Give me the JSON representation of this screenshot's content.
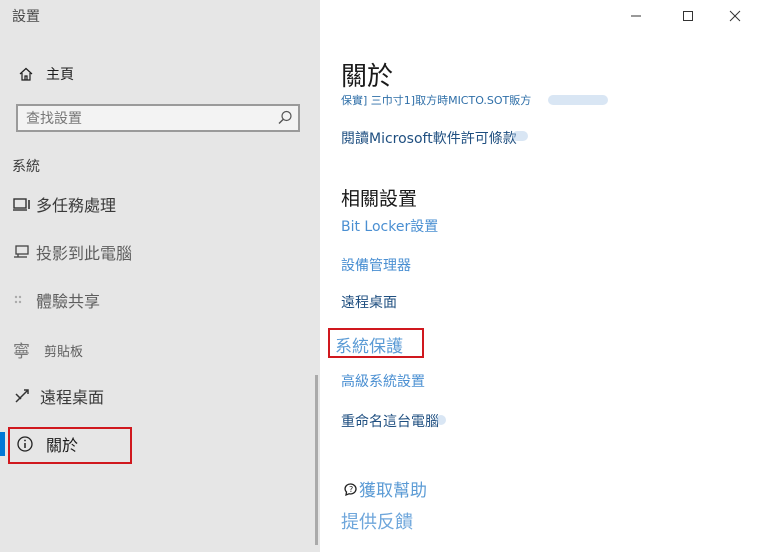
{
  "window": {
    "title": "設置",
    "controls": {
      "minimize": "minimize-icon",
      "maximize": "maximize-icon",
      "close": "close-icon"
    }
  },
  "sidebar": {
    "home_label": "主頁",
    "search_placeholder": "查找設置",
    "section_title": "系統",
    "items": [
      {
        "label": "多任務處理",
        "icon": "multitasking-icon"
      },
      {
        "label": "投影到此電腦",
        "icon": "project-icon"
      },
      {
        "label": "體驗共享",
        "icon": "shared-experiences-icon"
      },
      {
        "label": "剪貼板",
        "icon": "clipboard-icon"
      },
      {
        "label": "遠程桌面",
        "icon": "remote-desktop-icon"
      },
      {
        "label": "關於",
        "icon": "info-icon",
        "active": true
      }
    ]
  },
  "main": {
    "title": "關於",
    "service_link": "保實] 三巾寸1]取方時MICTO.SOT販方",
    "license_link": "閱讀Microsoft軟件許可條款",
    "related": {
      "title": "相關設置",
      "links": [
        {
          "label": "Bit Locker設置"
        },
        {
          "label": "設備管理器"
        },
        {
          "label": "遠程桌面"
        },
        {
          "label": "系統保護",
          "highlighted": true
        },
        {
          "label": "高級系統設置"
        },
        {
          "label": "重命名這台電腦"
        }
      ]
    },
    "help_label": "獲取幫助",
    "feedback_label": "提供反饋"
  },
  "colors": {
    "sidebar_bg": "#e6e6e6",
    "accent": "#0078d7",
    "link": "#4a8fd2",
    "highlight_border": "#d0181e"
  }
}
